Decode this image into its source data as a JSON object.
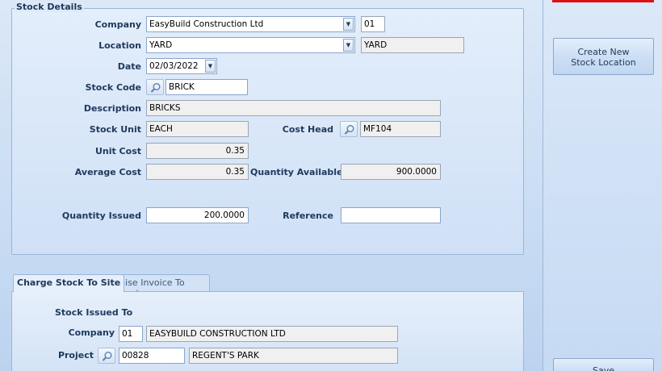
{
  "stock_details": {
    "title": "Stock Details",
    "company_label": "Company",
    "company_value": "EasyBuild Construction Ltd",
    "company_code": "01",
    "location_label": "Location",
    "location_value": "YARD",
    "location_desc": "YARD",
    "date_label": "Date",
    "date_value": "02/03/2022",
    "stock_code_label": "Stock Code",
    "stock_code_value": "BRICK",
    "description_label": "Description",
    "description_value": "BRICKS",
    "stock_unit_label": "Stock Unit",
    "stock_unit_value": "EACH",
    "cost_head_label": "Cost Head",
    "cost_head_value": "MF104",
    "unit_cost_label": "Unit Cost",
    "unit_cost_value": "0.35",
    "average_cost_label": "Average Cost",
    "average_cost_value": "0.35",
    "quantity_available_label": "Quantity Available",
    "quantity_available_value": "900.0000",
    "quantity_issued_label": "Quantity Issued",
    "quantity_issued_value": "200.0000",
    "reference_label": "Reference",
    "reference_value": ""
  },
  "side_buttons": {
    "create_location": "Create New\nStock Location",
    "save": "Save"
  },
  "tabs": [
    {
      "label": "Charge Stock To Site",
      "active": true
    },
    {
      "label": "Raise Invoice To Client",
      "active": false
    }
  ],
  "charge_tab": {
    "section_title": "Stock Issued To",
    "company_label": "Company",
    "company_code": "01",
    "company_name": "EASYBUILD CONSTRUCTION LTD",
    "project_label": "Project",
    "project_code": "00828",
    "project_name": "REGENT'S PARK"
  },
  "colors": {
    "accent_red": "#e01010",
    "label_text": "#1e395b",
    "panel_bg": "#d6e5f8"
  },
  "icons": {
    "search": "magnifier-icon",
    "dropdown": "chevron-down-icon",
    "calendar_dropdown": "chevron-down-icon"
  }
}
